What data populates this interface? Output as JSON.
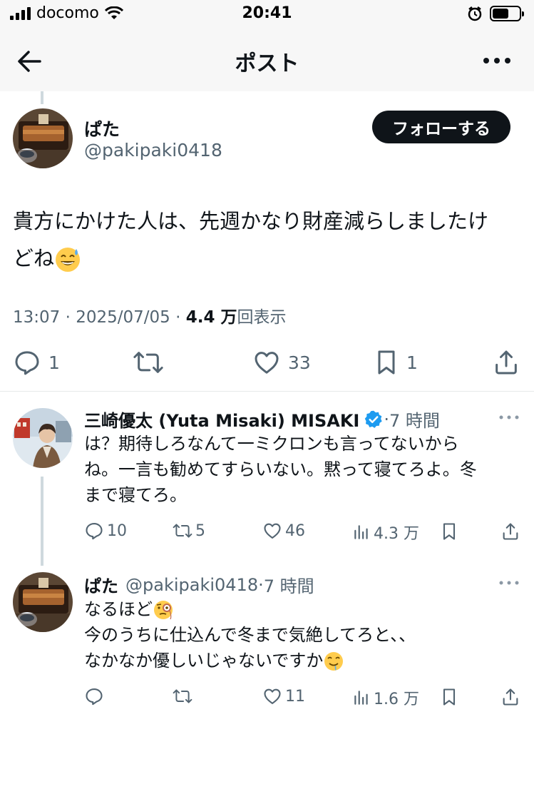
{
  "status_bar": {
    "carrier": "docomo",
    "time": "20:41"
  },
  "nav": {
    "title": "ポスト"
  },
  "post": {
    "author_name": "ぱた",
    "author_handle": "@pakipaki0418",
    "follow_label": "フォローする",
    "text_line1": "貴方にかけた人は、先週かなり財産減らしましたけ",
    "text_line2": "どね",
    "time": "13:07",
    "date": "2025/07/05",
    "views": "4.4 万",
    "views_suffix": "回表示",
    "replies": "1",
    "likes": "33",
    "bookmarks": "1"
  },
  "replies": [
    {
      "name": "三崎優太 (Yuta Misaki) MISAKI",
      "verified": true,
      "time": "7 時間",
      "line1": "は？期待しろなんて一ミクロンも言ってないから",
      "line2": "ね。一言も勧めてすらいない。黙って寝てろよ。冬",
      "line3": "まで寝てろ。",
      "replies": "10",
      "reposts": "5",
      "likes": "46",
      "views": "4.3 万"
    },
    {
      "name": "ぱた",
      "handle": "@pakipaki0418",
      "time": "7 時間",
      "line1": "なるほど",
      "line2": "今のうちに仕込んで冬まで気絶してろと、、",
      "line3": "なかなか優しいじゃないですか",
      "likes": "11",
      "views": "1.6 万"
    }
  ],
  "colors": {
    "accent": "#1d9bf0",
    "text": "#0f1419",
    "muted": "#536471"
  }
}
